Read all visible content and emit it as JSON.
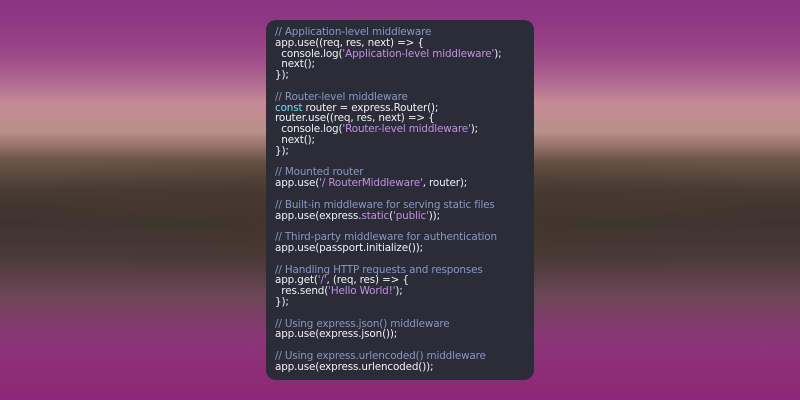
{
  "snippet": {
    "lines": [
      [
        {
          "t": "comment",
          "v": "// Application-level middleware"
        }
      ],
      [
        {
          "t": "plain",
          "v": "app.use((req, res, next) => {"
        }
      ],
      [
        {
          "t": "plain",
          "v": "  console.log("
        },
        {
          "t": "string",
          "v": "'Application-level middleware'"
        },
        {
          "t": "plain",
          "v": ");"
        }
      ],
      [
        {
          "t": "plain",
          "v": "  next();"
        }
      ],
      [
        {
          "t": "plain",
          "v": "});"
        }
      ],
      [],
      [
        {
          "t": "comment",
          "v": "// Router-level middleware"
        }
      ],
      [
        {
          "t": "keyword",
          "v": "const"
        },
        {
          "t": "plain",
          "v": " router = express.Router();"
        }
      ],
      [
        {
          "t": "plain",
          "v": "router.use((req, res, next) => {"
        }
      ],
      [
        {
          "t": "plain",
          "v": "  console.log("
        },
        {
          "t": "string",
          "v": "'Router-level middleware'"
        },
        {
          "t": "plain",
          "v": ");"
        }
      ],
      [
        {
          "t": "plain",
          "v": "  next();"
        }
      ],
      [
        {
          "t": "plain",
          "v": "});"
        }
      ],
      [],
      [
        {
          "t": "comment",
          "v": "// Mounted router"
        }
      ],
      [
        {
          "t": "plain",
          "v": "app.use("
        },
        {
          "t": "string",
          "v": "'/ RouterMiddleware'"
        },
        {
          "t": "plain",
          "v": ", router);"
        }
      ],
      [],
      [
        {
          "t": "comment",
          "v": "// Built-in middleware for serving static files"
        }
      ],
      [
        {
          "t": "plain",
          "v": "app.use(express."
        },
        {
          "t": "string",
          "v": "static"
        },
        {
          "t": "plain",
          "v": "("
        },
        {
          "t": "string",
          "v": "'public'"
        },
        {
          "t": "plain",
          "v": "));"
        }
      ],
      [],
      [
        {
          "t": "comment",
          "v": "// Third-party middleware for authentication"
        }
      ],
      [
        {
          "t": "plain",
          "v": "app.use(passport.initialize());"
        }
      ],
      [],
      [
        {
          "t": "comment",
          "v": "// Handling HTTP requests and responses"
        }
      ],
      [
        {
          "t": "plain",
          "v": "app.get("
        },
        {
          "t": "string",
          "v": "'/'"
        },
        {
          "t": "plain",
          "v": ", (req, res) => {"
        }
      ],
      [
        {
          "t": "plain",
          "v": "  res.send("
        },
        {
          "t": "string",
          "v": "'Hello World!'"
        },
        {
          "t": "plain",
          "v": ");"
        }
      ],
      [
        {
          "t": "plain",
          "v": "});"
        }
      ],
      [],
      [
        {
          "t": "comment",
          "v": "// Using express.json() middleware"
        }
      ],
      [
        {
          "t": "plain",
          "v": "app.use(express.json());"
        }
      ],
      [],
      [
        {
          "t": "comment",
          "v": "// Using express.urlencoded() middleware"
        }
      ],
      [
        {
          "t": "plain",
          "v": "app.use(express.urlencoded());"
        }
      ]
    ]
  },
  "colors": {
    "window_bg": "#2a2d37",
    "comment": "#8d93c6",
    "string": "#c48ee0",
    "keyword": "#7ad8f2",
    "text": "#eef0f4"
  }
}
